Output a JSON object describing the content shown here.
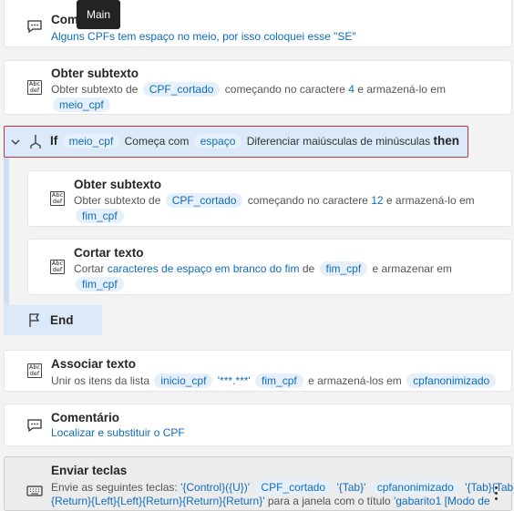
{
  "tooltip": "Main",
  "comment1": {
    "title": "Com",
    "text": "Alguns CPFs tem espaço no meio, por isso coloquei esse \"SE\""
  },
  "subtext1": {
    "title": "Obter subtexto",
    "prefix": "Obter subtexto de",
    "var1": "CPF_cortado",
    "mid": "começando no caractere",
    "num": "4",
    "suffix": "e armazená-lo em",
    "var2": "meio_cpf"
  },
  "if_block": {
    "keyword": "If",
    "var": "meio_cpf",
    "op": "Começa com",
    "value": "espaço",
    "option": "Diferenciar maiúsculas de minúsculas",
    "then": "then"
  },
  "subtext2": {
    "title": "Obter subtexto",
    "prefix": "Obter subtexto de",
    "var1": "CPF_cortado",
    "mid": "começando no caractere",
    "num": "12",
    "suffix": "e armazená-lo em",
    "var2": "fim_cpf"
  },
  "trim": {
    "title": "Cortar texto",
    "prefix": "Cortar",
    "link": "caracteres de espaço em branco do fim",
    "de": "de",
    "var1": "fim_cpf",
    "suffix": "e armazenar em",
    "var2": "fim_cpf"
  },
  "end": {
    "label": "End"
  },
  "join": {
    "title": "Associar texto",
    "prefix": "Unir os itens da lista",
    "var1": "inicio_cpf",
    "literal": "'***.***'",
    "var2": "fim_cpf",
    "suffix": "e armazená-los em",
    "var3": "cpfanonimizado"
  },
  "comment2": {
    "title": "Comentário",
    "text": "Localizar e substituir o CPF"
  },
  "sendkeys": {
    "title": "Enviar teclas",
    "prefix": "Envie as seguintes teclas:",
    "k1": "'{Control}({U})'",
    "var1": "CPF_cortado",
    "k2": "'{Tab}'",
    "var2": "cpfanonimizado",
    "k3": "'{Tab}{Tab}",
    "k4": "{Return}{Left}{Left}{Return}{Return}{Return}'",
    "mid": "para a janela com o título",
    "win": "'gabarito1 [Modo de"
  }
}
